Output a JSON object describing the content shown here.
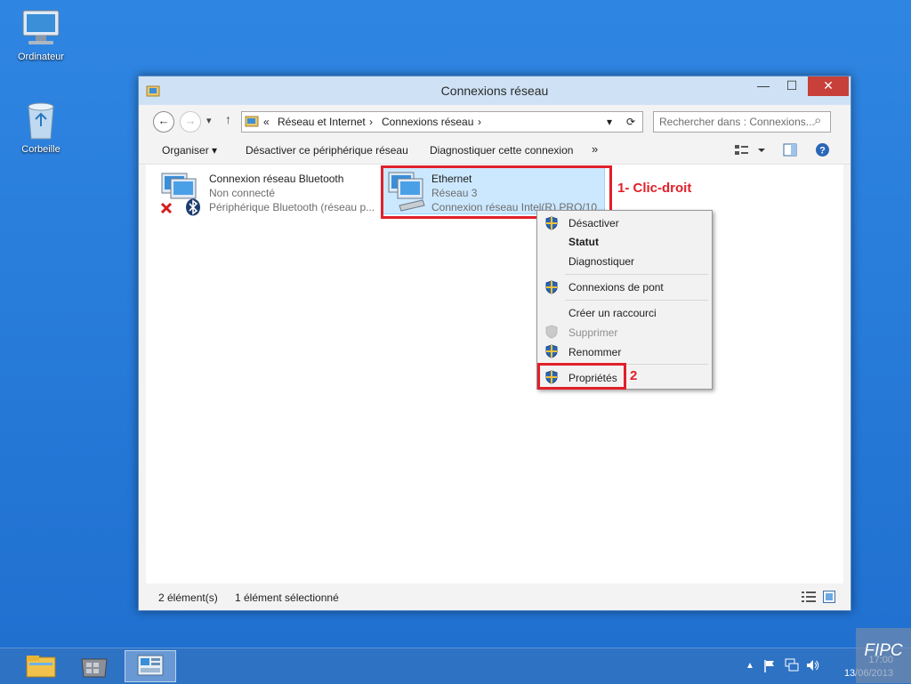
{
  "desktop": {
    "icons": [
      {
        "label": "Ordinateur",
        "icon": "computer-icon"
      },
      {
        "label": "Corbeille",
        "icon": "recycle-bin-icon"
      }
    ]
  },
  "window": {
    "title": "Connexions réseau",
    "buttons": {
      "minimize": "—",
      "maximize": "☐",
      "close": "✕"
    }
  },
  "address": {
    "back": "←",
    "forward": "→",
    "dropdown": "▾",
    "up": "↑",
    "prefix": "«",
    "crumbs": [
      "Réseau et Internet",
      "Connexions réseau"
    ],
    "sep": "›",
    "refresh": "⟳",
    "search_placeholder": "Rechercher dans : Connexions...",
    "search_icon": "⌕"
  },
  "commandbar": {
    "organize": "Organiser ▾",
    "disable": "Désactiver ce périphérique réseau",
    "diagnose": "Diagnostiquer cette connexion",
    "more": "»"
  },
  "items": [
    {
      "name": "Connexion réseau Bluetooth",
      "status": "Non connecté",
      "device": "Périphérique Bluetooth (réseau p..."
    },
    {
      "name": "Ethernet",
      "status": "Réseau  3",
      "device": "Connexion réseau Intel(R) PRO/10..."
    }
  ],
  "annotations": {
    "step1": "1- Clic-droit",
    "step2": "2"
  },
  "context_menu": [
    {
      "label": "Désactiver",
      "shield": true,
      "disabled": false,
      "bold": false
    },
    {
      "label": "Statut",
      "shield": false,
      "disabled": false,
      "bold": true
    },
    {
      "label": "Diagnostiquer",
      "shield": false,
      "disabled": false,
      "bold": false
    },
    {
      "label": "Connexions de pont",
      "shield": true,
      "disabled": false,
      "bold": false
    },
    {
      "label": "Créer un raccourci",
      "shield": false,
      "disabled": false,
      "bold": false
    },
    {
      "label": "Supprimer",
      "shield": true,
      "disabled": true,
      "bold": false
    },
    {
      "label": "Renommer",
      "shield": true,
      "disabled": false,
      "bold": false
    },
    {
      "label": "Propriétés",
      "shield": true,
      "disabled": false,
      "bold": false
    }
  ],
  "statusbar": {
    "count": "2 élément(s)",
    "selected": "1 élément sélectionné"
  },
  "taskbar": {
    "apps": [
      "file-explorer-icon",
      "store-icon",
      "control-panel-icon"
    ],
    "tray": {
      "expand": "▲"
    },
    "time": "17:00",
    "date": "13/06/2013"
  },
  "watermark": "FIPC",
  "colors": {
    "accent": "#e0202a",
    "selection": "#cce8ff",
    "taskbar": "#2e72c4"
  }
}
